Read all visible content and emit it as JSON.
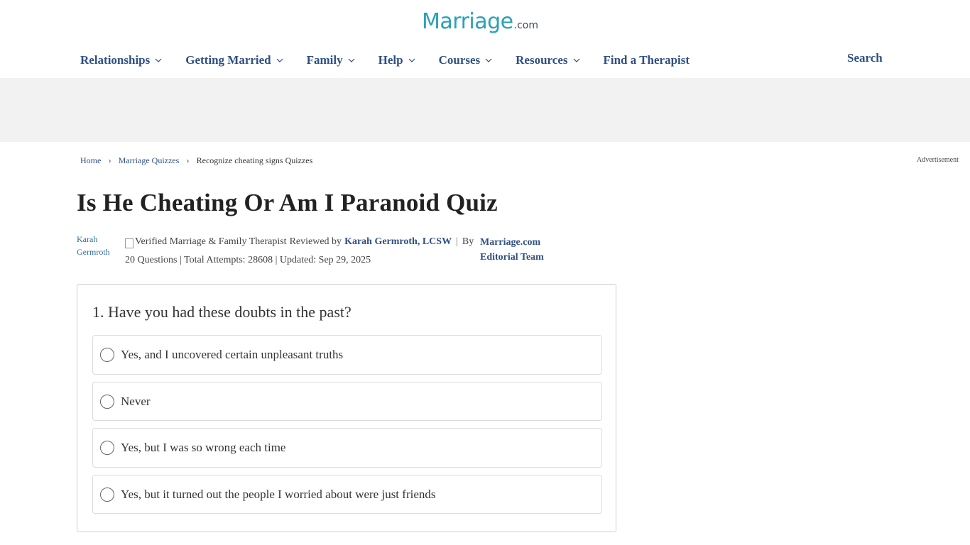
{
  "logo": {
    "main": "Marriage",
    "suffix": ".com"
  },
  "nav": {
    "items": [
      {
        "label": "Relationships",
        "dropdown": true
      },
      {
        "label": "Getting Married",
        "dropdown": true
      },
      {
        "label": "Family",
        "dropdown": true
      },
      {
        "label": "Help",
        "dropdown": true
      },
      {
        "label": "Courses",
        "dropdown": true
      },
      {
        "label": "Resources",
        "dropdown": true
      },
      {
        "label": "Find a Therapist",
        "dropdown": false
      }
    ],
    "search_label": "Search"
  },
  "breadcrumb": {
    "items": [
      "Home",
      "Marriage Quizzes",
      "Recognize cheating signs Quizzes"
    ],
    "separator": "›"
  },
  "advertisement_label": "Advertisement",
  "page": {
    "title": "Is He Cheating Or Am I Paranoid Quiz"
  },
  "meta": {
    "avatar_alt": "Karah Germroth",
    "badge_alt": "Verified Marriage & Family Therapist",
    "reviewed_by_prefix": "Reviewed by",
    "reviewer": "Karah Germroth, LCSW",
    "pipe": "|",
    "by_label": "By",
    "author": "Marriage.com Editorial Team",
    "stats": "20 Questions | Total Attempts: 28608 | Updated: Sep 29, 2025"
  },
  "quiz": {
    "question": "1. Have you had these doubts in the past?",
    "options": [
      "Yes, and I uncovered certain unpleasant truths",
      "Never",
      "Yes, but I was so wrong each time",
      "Yes, but it turned out the people I worried about were just friends"
    ]
  },
  "colors": {
    "brand_teal": "#2aa1b8",
    "nav_blue": "#2f4f85",
    "ad_band": "#f2f2f2"
  }
}
